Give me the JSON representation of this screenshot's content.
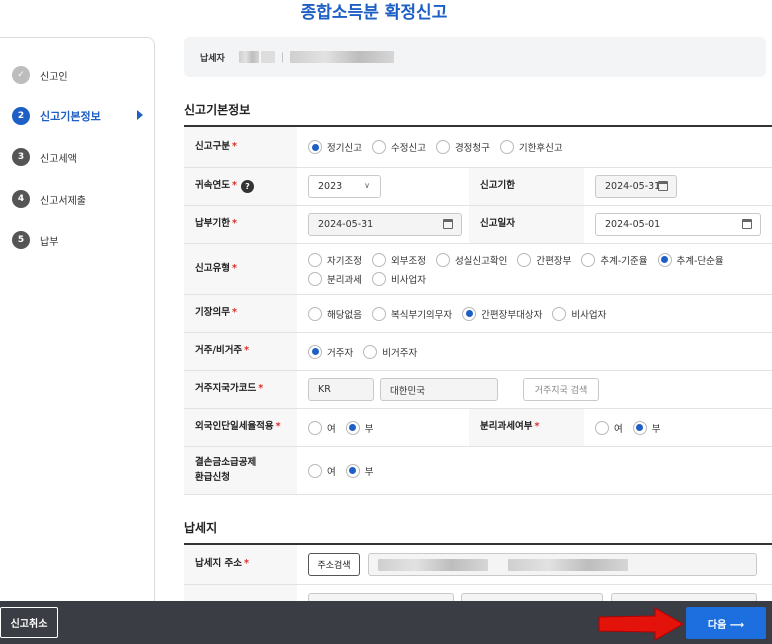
{
  "header": {
    "title": "종합소득분 확정신고"
  },
  "sidebar": {
    "steps": [
      {
        "num": "✓",
        "label": "신고인"
      },
      {
        "num": "2",
        "label": "신고기본정보"
      },
      {
        "num": "3",
        "label": "신고세액"
      },
      {
        "num": "4",
        "label": "신고서제출"
      },
      {
        "num": "5",
        "label": "납부"
      }
    ]
  },
  "payer": {
    "label": "납세자"
  },
  "basic": {
    "section_title": "신고기본정보",
    "filing_type": {
      "label": "신고구분",
      "options": [
        "정기신고",
        "수정신고",
        "경정청구",
        "기한후신고"
      ],
      "selected": "정기신고"
    },
    "tax_year": {
      "label": "귀속연도",
      "value": "2023",
      "help": "?"
    },
    "filing_deadline": {
      "label": "신고기한",
      "value": "2024-05-31"
    },
    "payment_deadline": {
      "label": "납부기한",
      "value": "2024-05-31"
    },
    "filing_date": {
      "label": "신고일자",
      "value": "2024-05-01"
    },
    "report_type": {
      "label": "신고유형",
      "options": [
        "자기조정",
        "외부조정",
        "성실신고확인",
        "간편장부",
        "추계-기준율",
        "추계-단순율",
        "분리과세",
        "비사업자"
      ],
      "selected": "추계-단순율"
    },
    "bookkeeping": {
      "label": "기장의무",
      "options": [
        "해당없음",
        "복식부기의무자",
        "간편장부대상자",
        "비사업자"
      ],
      "selected": "간편장부대상자"
    },
    "residency": {
      "label": "거주/비거주",
      "options": [
        "거주자",
        "비거주자"
      ],
      "selected": "거주자"
    },
    "country": {
      "label": "거주지국가코드",
      "code": "KR",
      "name": "대한민국",
      "search_button": "거주지국 검색"
    },
    "foreigner_flat_rate": {
      "label": "외국인단일세율적용",
      "options": [
        "여",
        "부"
      ],
      "selected": "부"
    },
    "separate_tax": {
      "label": "분리과세여부",
      "options": [
        "여",
        "부"
      ],
      "selected": "부"
    },
    "loss_carryback": {
      "label_line1": "결손금소급공제",
      "label_line2": "환급신청",
      "options": [
        "여",
        "부"
      ],
      "selected": "부"
    }
  },
  "taxplace": {
    "section_title": "납세지",
    "address": {
      "label": "납세지 주소",
      "search_button": "주소검색"
    }
  },
  "footer": {
    "cancel": "신고취소",
    "next": "다음 ⟶"
  },
  "colors": {
    "accent": "#1d5fc4",
    "next_button": "#1d6fe0",
    "bottom_bar": "#3a3d44",
    "required": "#d9302c",
    "annotation_arrow": "#e3120b"
  }
}
